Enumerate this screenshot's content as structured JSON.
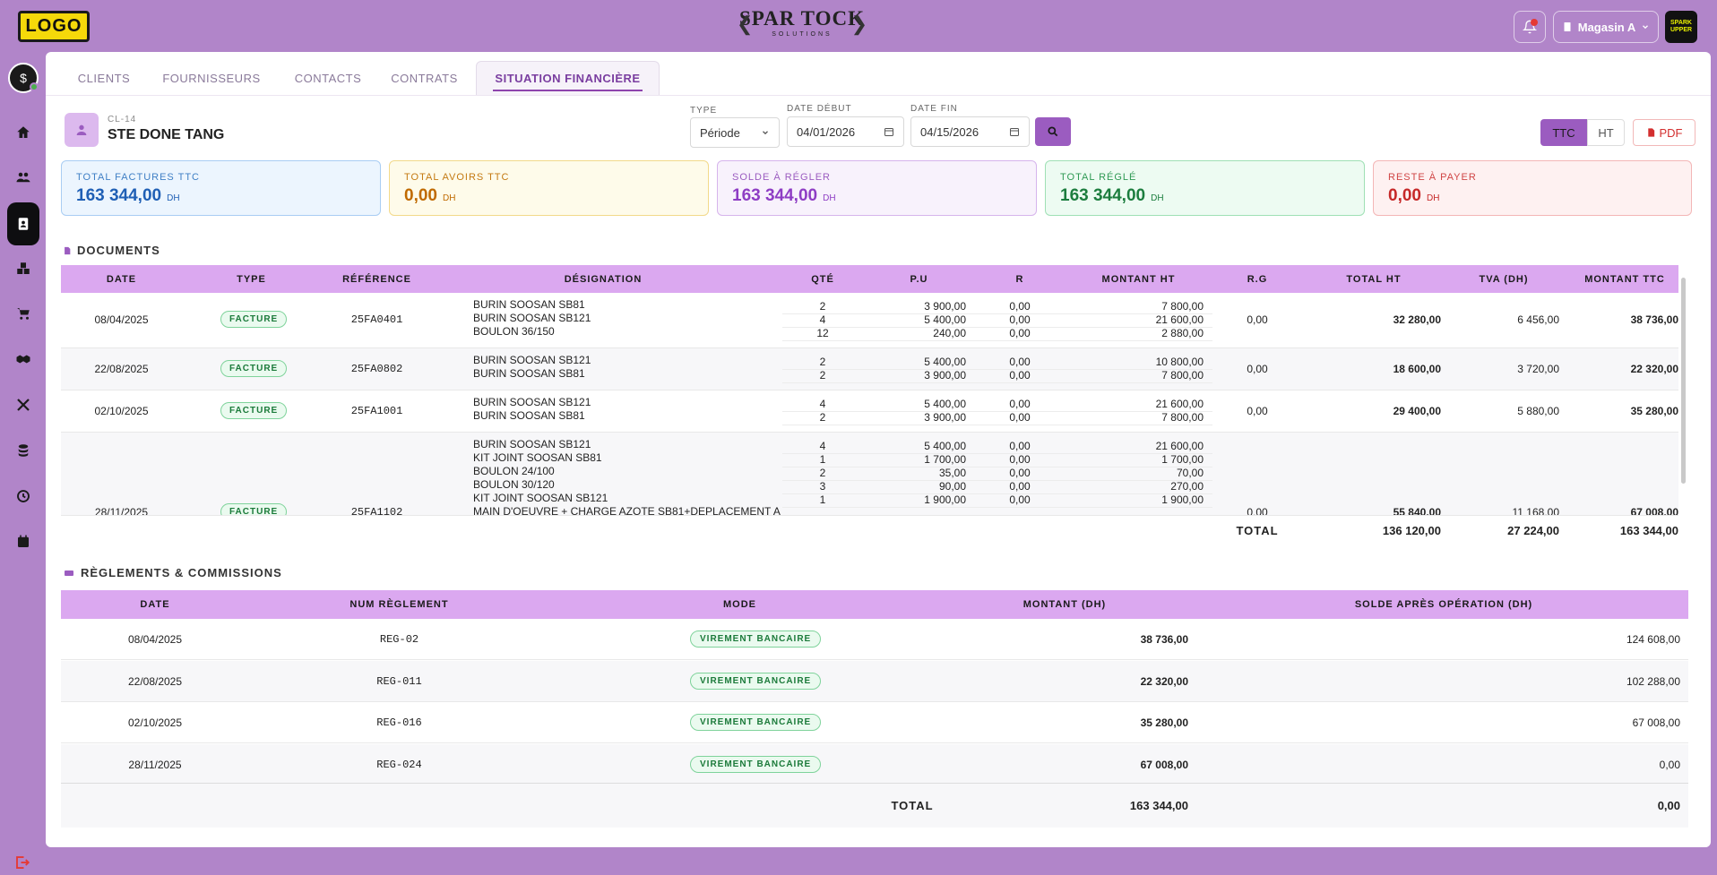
{
  "header": {
    "logo": "LOGO",
    "brand_title": "SPAR TOCK",
    "brand_sub": "SOLUTIONS",
    "store": "Magasin A",
    "avatar_text": "SPARK UPPER"
  },
  "sidebar": {
    "user_initial": "S",
    "items": [
      "home-icon",
      "users-icon",
      "document-icon",
      "boxes-icon",
      "cart-icon",
      "handshake-icon",
      "tools-icon",
      "coins-icon",
      "history-icon",
      "calendar-x-icon"
    ]
  },
  "tabs": [
    {
      "label": "CLIENTS"
    },
    {
      "label": "FOURNISSEURS"
    },
    {
      "label": "CONTACTS"
    },
    {
      "label": "CONTRATS"
    },
    {
      "label": "SITUATION FINANCIÈRE"
    }
  ],
  "client": {
    "code": "CL-14",
    "name": "STE DONE TANG"
  },
  "filters": {
    "type_label": "TYPE",
    "type_value": "Période",
    "start_label": "DATE DÉBUT",
    "start_value": "04/01/2026",
    "end_label": "DATE FIN",
    "end_value": "04/15/2026"
  },
  "toggle": {
    "ttc": "TTC",
    "ht": "HT",
    "pdf": "PDF"
  },
  "cards": [
    {
      "label": "TOTAL FACTURES TTC",
      "value": "163 344,00",
      "unit": "DH"
    },
    {
      "label": "TOTAL AVOIRS TTC",
      "value": "0,00",
      "unit": "DH"
    },
    {
      "label": "SOLDE À RÉGLER",
      "value": "163 344,00",
      "unit": "DH"
    },
    {
      "label": "TOTAL RÉGLÉ",
      "value": "163 344,00",
      "unit": "DH"
    },
    {
      "label": "RESTE À PAYER",
      "value": "0,00",
      "unit": "DH"
    }
  ],
  "documents": {
    "title": "DOCUMENTS",
    "headers": [
      "DATE",
      "TYPE",
      "RÉFÉRENCE",
      "DÉSIGNATION",
      "QTÉ",
      "P.U",
      "R",
      "MONTANT HT",
      "R.G",
      "TOTAL HT",
      "TVA (DH)",
      "MONTANT TTC"
    ],
    "rows": [
      {
        "date": "08/04/2025",
        "type": "FACTURE",
        "ref": "25FA0401",
        "rg": "0,00",
        "total_ht": "32 280,00",
        "tva": "6 456,00",
        "ttc": "38 736,00",
        "lines": [
          [
            "BURIN SOOSAN SB81",
            "2",
            "3 900,00",
            "0,00",
            "7 800,00"
          ],
          [
            "BURIN SOOSAN SB121",
            "4",
            "5 400,00",
            "0,00",
            "21 600,00"
          ],
          [
            "BOULON 36/150",
            "12",
            "240,00",
            "0,00",
            "2 880,00"
          ]
        ]
      },
      {
        "date": "22/08/2025",
        "type": "FACTURE",
        "ref": "25FA0802",
        "rg": "0,00",
        "total_ht": "18 600,00",
        "tva": "3 720,00",
        "ttc": "22 320,00",
        "lines": [
          [
            "BURIN SOOSAN SB121",
            "2",
            "5 400,00",
            "0,00",
            "10 800,00"
          ],
          [
            "BURIN SOOSAN SB81",
            "2",
            "3 900,00",
            "0,00",
            "7 800,00"
          ]
        ]
      },
      {
        "date": "02/10/2025",
        "type": "FACTURE",
        "ref": "25FA1001",
        "rg": "0,00",
        "total_ht": "29 400,00",
        "tva": "5 880,00",
        "ttc": "35 280,00",
        "lines": [
          [
            "BURIN SOOSAN SB121",
            "4",
            "5 400,00",
            "0,00",
            "21 600,00"
          ],
          [
            "BURIN SOOSAN SB81",
            "2",
            "3 900,00",
            "0,00",
            "7 800,00"
          ]
        ]
      },
      {
        "date": "28/11/2025",
        "type": "FACTURE",
        "ref": "25FA1102",
        "rg": "0,00",
        "total_ht": "55 840,00",
        "tva": "11 168,00",
        "ttc": "67 008,00",
        "lines": [
          [
            "BURIN SOOSAN SB121",
            "4",
            "5 400,00",
            "0,00",
            "21 600,00"
          ],
          [
            "KIT JOINT SOOSAN SB81",
            "1",
            "1 700,00",
            "0,00",
            "1 700,00"
          ],
          [
            "BOULON 24/100",
            "2",
            "35,00",
            "0,00",
            "70,00"
          ],
          [
            "BOULON 30/120",
            "3",
            "90,00",
            "0,00",
            "270,00"
          ],
          [
            "KIT JOINT SOOSAN SB121",
            "1",
            "1 900,00",
            "0,00",
            "1 900,00"
          ],
          [
            "MAIN D'OEUVRE + CHARGE AZOTE SB81+DEPLACEMENT A",
            "",
            "",
            "",
            ""
          ]
        ]
      }
    ],
    "total_label": "TOTAL",
    "total_ht": "136 120,00",
    "total_tva": "27 224,00",
    "total_ttc": "163 344,00"
  },
  "reglements": {
    "title": "RÈGLEMENTS & COMMISSIONS",
    "headers": [
      "DATE",
      "NUM RÈGLEMENT",
      "MODE",
      "MONTANT (DH)",
      "SOLDE APRÈS OPÉRATION (DH)"
    ],
    "rows": [
      {
        "date": "08/04/2025",
        "num": "REG-02",
        "mode": "VIREMENT BANCAIRE",
        "montant": "38 736,00",
        "solde": "124 608,00"
      },
      {
        "date": "22/08/2025",
        "num": "REG-011",
        "mode": "VIREMENT BANCAIRE",
        "montant": "22 320,00",
        "solde": "102 288,00"
      },
      {
        "date": "02/10/2025",
        "num": "REG-016",
        "mode": "VIREMENT BANCAIRE",
        "montant": "35 280,00",
        "solde": "67 008,00"
      },
      {
        "date": "28/11/2025",
        "num": "REG-024",
        "mode": "VIREMENT BANCAIRE",
        "montant": "67 008,00",
        "solde": "0,00"
      }
    ],
    "total_label": "TOTAL",
    "total_montant": "163 344,00",
    "total_solde": "0,00"
  }
}
